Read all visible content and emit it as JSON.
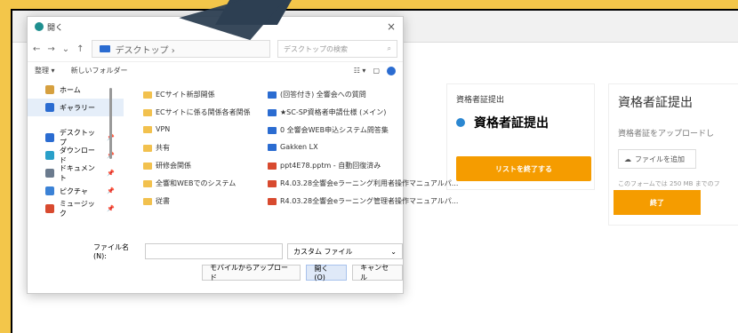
{
  "dialog": {
    "title": "開く",
    "close": "×",
    "address": "デスクトップ ›",
    "search_placeholder": "デスクトップの検索",
    "command_left": "整理 ▾",
    "command_new": "新しいフォルダー",
    "view_label": "☷ ▾"
  },
  "sidebar": [
    {
      "label": "ホーム",
      "color": "#d6a03f"
    },
    {
      "label": "ギャラリー",
      "color": "#2b6cd1"
    },
    {
      "label": "デスクトップ",
      "color": "#2b6cd1",
      "pin": "📌"
    },
    {
      "label": "ダウンロード",
      "color": "#2aa0c9",
      "pin": "📌"
    },
    {
      "label": "ドキュメント",
      "color": "#6b7b8e",
      "pin": "📌"
    },
    {
      "label": "ピクチャ",
      "color": "#3b82d6",
      "pin": "📌"
    },
    {
      "label": "ミュージック",
      "color": "#d84a2f",
      "pin": "📌"
    }
  ],
  "files_left": [
    "ECサイト新部開係",
    "ECサイトに係る関係各者関係",
    "VPN",
    "共有",
    "研修会関係",
    "全響和WEBでのシステム",
    "従書"
  ],
  "files_right": [
    "(回答付き) 全響会への質問",
    "★SC-SP資格者申請仕様 (メイン)",
    "0 全響会WEB申込システム問答集",
    "Gakken LX",
    "ppt4E78.pptm - 自動回復済み",
    "R4.03.28全響会eラーニング利用者操作マニュアルパ...",
    "R4.03.28全響会eラーニング管理者操作マニュアルパ..."
  ],
  "bottom": {
    "filename_label": "ファイル名(N):",
    "file_type": "カスタム ファイル",
    "upload_from_mobile": "モバイルからアップロード",
    "open": "開く(O)",
    "cancel": "キャンセル"
  },
  "panel_left": {
    "title": "資格者証提出",
    "headline": "資格者証提出",
    "button": "リストを終了する"
  },
  "panel_right": {
    "head": "資格者証提出",
    "sub": "資格者証をアップロードし",
    "upload": "ファイルを追加",
    "note": "このフォームでは 250 MB までのフ",
    "finish": "終了"
  }
}
